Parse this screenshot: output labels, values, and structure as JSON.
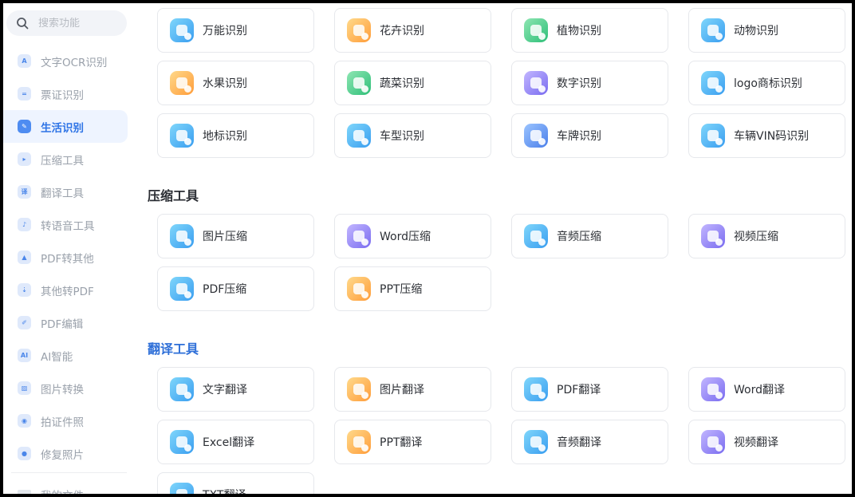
{
  "search": {
    "placeholder": "搜索功能"
  },
  "sidebar": {
    "items": [
      {
        "label": "文字OCR识别",
        "glyph": "A",
        "icon": "text-ocr-icon"
      },
      {
        "label": "票证识别",
        "glyph": "=",
        "icon": "ticket-icon"
      },
      {
        "label": "生活识别",
        "glyph": "✎",
        "icon": "life-scan-icon",
        "active": true
      },
      {
        "label": "压缩工具",
        "glyph": "▸",
        "icon": "compress-icon"
      },
      {
        "label": "翻译工具",
        "glyph": "译",
        "icon": "translate-icon"
      },
      {
        "label": "转语音工具",
        "glyph": "♪",
        "icon": "speech-icon"
      },
      {
        "label": "PDF转其他",
        "glyph": "▲",
        "icon": "pdf-convert-icon"
      },
      {
        "label": "其他转PDF",
        "glyph": "⇣",
        "icon": "to-pdf-icon"
      },
      {
        "label": "PDF编辑",
        "glyph": "✐",
        "icon": "pdf-edit-icon"
      },
      {
        "label": "AI智能",
        "glyph": "AI",
        "icon": "ai-icon"
      },
      {
        "label": "图片转换",
        "glyph": "▨",
        "icon": "image-convert-icon"
      },
      {
        "label": "拍证件照",
        "glyph": "◉",
        "icon": "id-photo-icon"
      },
      {
        "label": "修复照片",
        "glyph": "●",
        "icon": "repair-photo-icon"
      }
    ],
    "bottom_label": "我的文件"
  },
  "sections": {
    "life": [
      {
        "label": "万能识别",
        "color": "g-blue",
        "icon": "universal-scan-icon"
      },
      {
        "label": "花卉识别",
        "color": "g-orange",
        "icon": "flower-icon"
      },
      {
        "label": "植物识别",
        "color": "g-green",
        "icon": "plant-icon"
      },
      {
        "label": "动物识别",
        "color": "g-blue",
        "icon": "animal-icon"
      },
      {
        "label": "水果识别",
        "color": "g-orange",
        "icon": "fruit-icon"
      },
      {
        "label": "蔬菜识别",
        "color": "g-green",
        "icon": "vegetable-icon"
      },
      {
        "label": "数字识别",
        "color": "g-purple",
        "icon": "number-icon"
      },
      {
        "label": "logo商标识别",
        "color": "g-blue",
        "icon": "logo-icon"
      },
      {
        "label": "地标识别",
        "color": "g-blue",
        "icon": "landmark-icon"
      },
      {
        "label": "车型识别",
        "color": "g-blue",
        "icon": "car-model-icon"
      },
      {
        "label": "车牌识别",
        "color": "g-royal",
        "icon": "license-plate-icon"
      },
      {
        "label": "车辆VIN码识别",
        "color": "g-blue",
        "icon": "vin-icon"
      }
    ],
    "compress_title": "压缩工具",
    "compress": [
      {
        "label": "图片压缩",
        "color": "g-blue",
        "icon": "image-compress-icon"
      },
      {
        "label": "Word压缩",
        "color": "g-purple",
        "icon": "word-compress-icon"
      },
      {
        "label": "音频压缩",
        "color": "g-blue",
        "icon": "audio-compress-icon"
      },
      {
        "label": "视频压缩",
        "color": "g-purple",
        "icon": "video-compress-icon"
      },
      {
        "label": "PDF压缩",
        "color": "g-blue",
        "icon": "pdf-compress-icon"
      },
      {
        "label": "PPT压缩",
        "color": "g-orange",
        "icon": "ppt-compress-icon"
      }
    ],
    "translate_title": "翻译工具",
    "translate": [
      {
        "label": "文字翻译",
        "color": "g-blue",
        "icon": "text-translate-icon"
      },
      {
        "label": "图片翻译",
        "color": "g-orange",
        "icon": "image-translate-icon"
      },
      {
        "label": "PDF翻译",
        "color": "g-blue",
        "icon": "pdf-translate-icon"
      },
      {
        "label": "Word翻译",
        "color": "g-purple",
        "icon": "word-translate-icon"
      },
      {
        "label": "Excel翻译",
        "color": "g-blue",
        "icon": "excel-translate-icon"
      },
      {
        "label": "PPT翻译",
        "color": "g-orange",
        "icon": "ppt-translate-icon"
      },
      {
        "label": "音频翻译",
        "color": "g-blue",
        "icon": "audio-translate-icon"
      },
      {
        "label": "视频翻译",
        "color": "g-purple",
        "icon": "video-translate-icon"
      },
      {
        "label": "TXT翻译",
        "color": "g-blue",
        "icon": "txt-translate-icon"
      }
    ]
  }
}
